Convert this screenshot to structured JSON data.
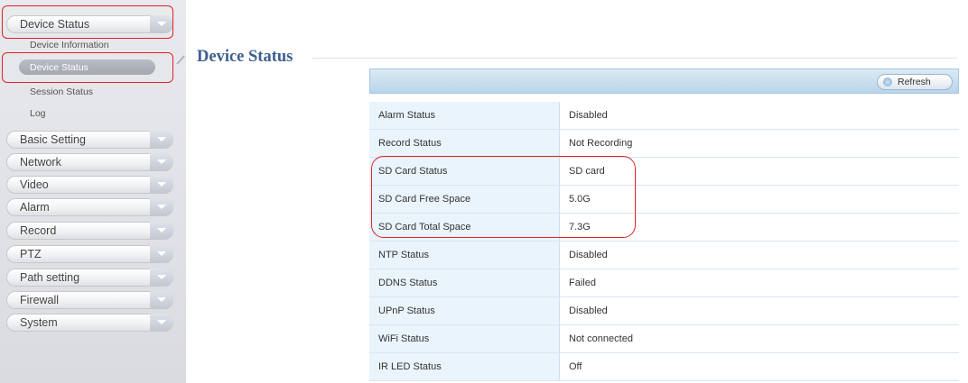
{
  "sidebar": {
    "groups": [
      {
        "label": "Device Status"
      },
      {
        "label": "Basic Setting"
      },
      {
        "label": "Network"
      },
      {
        "label": "Video"
      },
      {
        "label": "Alarm"
      },
      {
        "label": "Record"
      },
      {
        "label": "PTZ"
      },
      {
        "label": "Path setting"
      },
      {
        "label": "Firewall"
      },
      {
        "label": "System"
      }
    ],
    "sub_items": [
      {
        "label": "Device Information"
      },
      {
        "label": "Device Status"
      },
      {
        "label": "Session Status"
      },
      {
        "label": "Log"
      }
    ]
  },
  "page": {
    "title": "Device Status"
  },
  "toolbar": {
    "refresh_label": "Refresh"
  },
  "status_rows": [
    {
      "key": "Alarm Status",
      "value": "Disabled"
    },
    {
      "key": "Record Status",
      "value": "Not Recording"
    },
    {
      "key": "SD Card Status",
      "value": "SD card"
    },
    {
      "key": "SD Card Free Space",
      "value": "5.0G"
    },
    {
      "key": "SD Card Total Space",
      "value": "7.3G"
    },
    {
      "key": "NTP Status",
      "value": "Disabled"
    },
    {
      "key": "DDNS Status",
      "value": "Failed"
    },
    {
      "key": "UPnP Status",
      "value": "Disabled"
    },
    {
      "key": "WiFi Status",
      "value": "Not connected"
    },
    {
      "key": "IR LED Status",
      "value": "Off"
    }
  ],
  "colors": {
    "highlight": "#e0222a",
    "title": "#3f5f8f",
    "toolbar": "#c6dcef",
    "key_cell": "#eaf4fc"
  }
}
